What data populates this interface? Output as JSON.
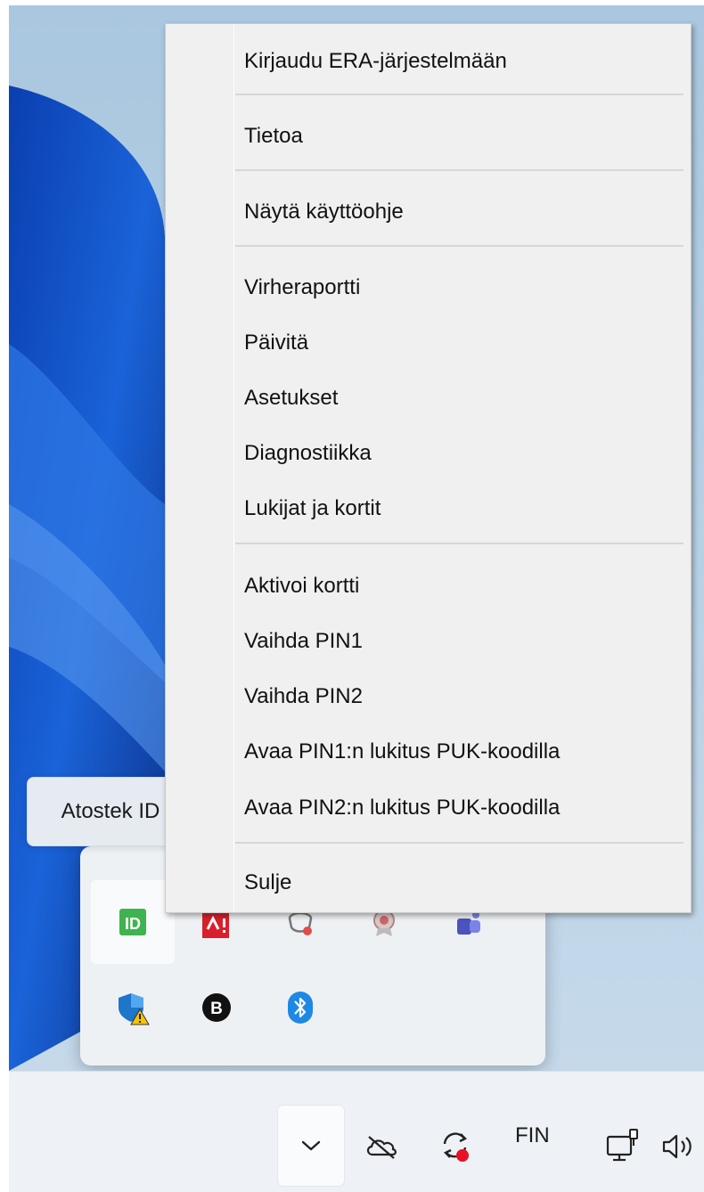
{
  "context_menu": {
    "items": [
      "Kirjaudu ERA-järjestelmään",
      "Tietoa",
      "Näytä käyttöohje",
      "Virheraportti",
      "Päivitä",
      "Asetukset",
      "Diagnostiikka",
      "Lukijat ja kortit",
      "Aktivoi kortti",
      "Vaihda PIN1",
      "Vaihda PIN2",
      "Avaa PIN1:n lukitus PUK-koodilla",
      "Avaa PIN2:n lukitus PUK-koodilla",
      "Sulje"
    ]
  },
  "tooltip": {
    "text": "Atostek ID"
  },
  "tray_overflow": {
    "icons": [
      "atostek-id-icon",
      "acrobat-alert-icon",
      "security-key-icon",
      "award-badge-icon",
      "teams-icon",
      "defender-warning-icon",
      "b-circle-icon",
      "bluetooth-icon"
    ],
    "atostek_icon_text": "ID",
    "b_icon_text": "B"
  },
  "taskbar": {
    "language": "FIN",
    "icons": [
      "chevron-up-icon",
      "onedrive-offline-icon",
      "sync-status-icon",
      "network-icon",
      "volume-icon"
    ]
  },
  "colors": {
    "menu_bg": "#f0f0f0",
    "atostek_green": "#3fb34f",
    "acrobat_red": "#d8202b",
    "bluetooth_blue": "#1e88e5",
    "record_red": "#e81123"
  }
}
